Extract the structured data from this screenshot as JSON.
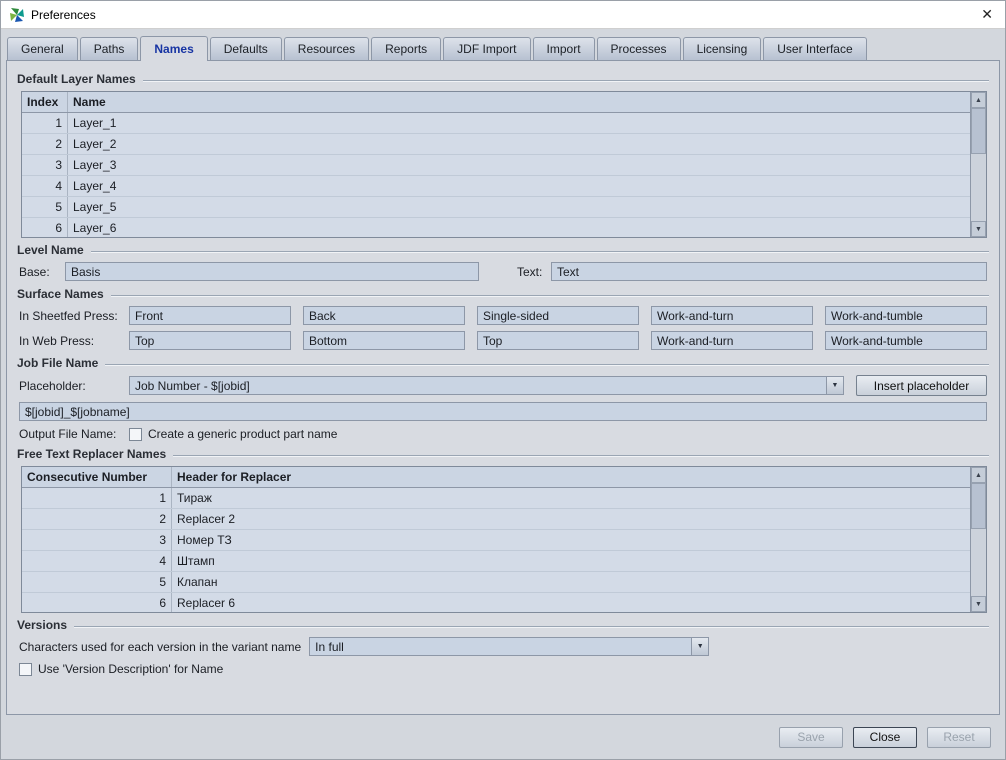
{
  "window": {
    "title": "Preferences"
  },
  "icons": {
    "close": "✕",
    "up": "▲",
    "down": "▼",
    "dropdown": "▼"
  },
  "colors": {
    "accent_tab": "#1734a3",
    "field_bg": "#c9d4e3",
    "panel_bg": "#d8dbe1",
    "header_bg": "#cbd5e3"
  },
  "tabs": {
    "items": [
      "General",
      "Paths",
      "Names",
      "Defaults",
      "Resources",
      "Reports",
      "JDF Import",
      "Import",
      "Processes",
      "Licensing",
      "User Interface"
    ],
    "active": "Names"
  },
  "default_layer_names": {
    "title": "Default Layer Names",
    "headers": [
      "Index",
      "Name"
    ],
    "rows": [
      [
        1,
        "Layer_1"
      ],
      [
        2,
        "Layer_2"
      ],
      [
        3,
        "Layer_3"
      ],
      [
        4,
        "Layer_4"
      ],
      [
        5,
        "Layer_5"
      ],
      [
        6,
        "Layer_6"
      ]
    ]
  },
  "level_name": {
    "title": "Level Name",
    "base_label": "Base:",
    "base_value": "Basis",
    "text_label": "Text:",
    "text_value": "Text"
  },
  "surface_names": {
    "title": "Surface Names",
    "sheetfed_label": "In Sheetfed Press:",
    "sheetfed": [
      "Front",
      "Back",
      "Single-sided",
      "Work-and-turn",
      "Work-and-tumble"
    ],
    "web_label": "In Web Press:",
    "web": [
      "Top",
      "Bottom",
      "Top",
      "Work-and-turn",
      "Work-and-tumble"
    ]
  },
  "job_file_name": {
    "title": "Job File Name",
    "placeholder_label": "Placeholder:",
    "placeholder_value": "Job Number - $[jobid]",
    "insert_button_label": "Insert placeholder",
    "pattern_value": "$[jobid]_$[jobname]",
    "output_label": "Output File Name:",
    "checkbox_label": "Create a generic product part name"
  },
  "free_text_replacers": {
    "title": "Free Text Replacer Names",
    "headers": [
      "Consecutive Number",
      "Header for Replacer"
    ],
    "rows": [
      [
        1,
        "Тираж"
      ],
      [
        2,
        "Replacer 2"
      ],
      [
        3,
        "Номер ТЗ"
      ],
      [
        4,
        "Штамп"
      ],
      [
        5,
        "Клапан"
      ],
      [
        6,
        "Replacer 6"
      ]
    ]
  },
  "versions": {
    "title": "Versions",
    "chars_label": "Characters used for each version in the variant name",
    "chars_value": "In full",
    "use_desc_label": "Use 'Version Description' for Name"
  },
  "footer": {
    "save_label": "Save",
    "close_label": "Close",
    "reset_label": "Reset"
  }
}
